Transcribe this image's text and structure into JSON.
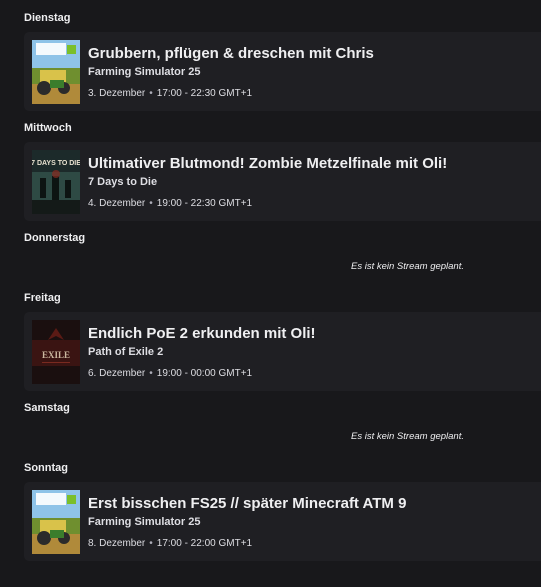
{
  "schedule": {
    "days": [
      {
        "label": "Dienstag",
        "stream": {
          "title": "Grubbern, pflügen & dreschen mit Chris",
          "game": "Farming Simulator 25",
          "date": "3. Dezember",
          "separator": "•",
          "time": "17:00 - 22:30 GMT+1",
          "cover_logo": "Farming Simulator 25"
        }
      },
      {
        "label": "Mittwoch",
        "stream": {
          "title": "Ultimativer Blutmond! Zombie Metzelfinale mit Oli!",
          "game": "7 Days to Die",
          "date": "4. Dezember",
          "separator": "•",
          "time": "19:00 - 22:30 GMT+1",
          "cover_logo": "7 DAYS TO DIE"
        }
      },
      {
        "label": "Donnerstag",
        "empty_text": "Es ist kein Stream geplant."
      },
      {
        "label": "Freitag",
        "stream": {
          "title": "Endlich PoE 2 erkunden mit Oli!",
          "game": "Path of Exile 2",
          "date": "6. Dezember",
          "separator": "•",
          "time": "19:00 - 00:00 GMT+1",
          "cover_logo": "EXILE"
        }
      },
      {
        "label": "Samstag",
        "empty_text": "Es ist kein Stream geplant."
      },
      {
        "label": "Sonntag",
        "stream": {
          "title": "Erst bisschen FS25 // später Minecraft ATM 9",
          "game": "Farming Simulator 25",
          "date": "8. Dezember",
          "separator": "•",
          "time": "17:00 - 22:00 GMT+1",
          "cover_logo": "Farming Simulator 25"
        }
      }
    ]
  },
  "colors": {
    "background": "#18181b",
    "card": "#1f1f23",
    "text": "#efeff1"
  }
}
